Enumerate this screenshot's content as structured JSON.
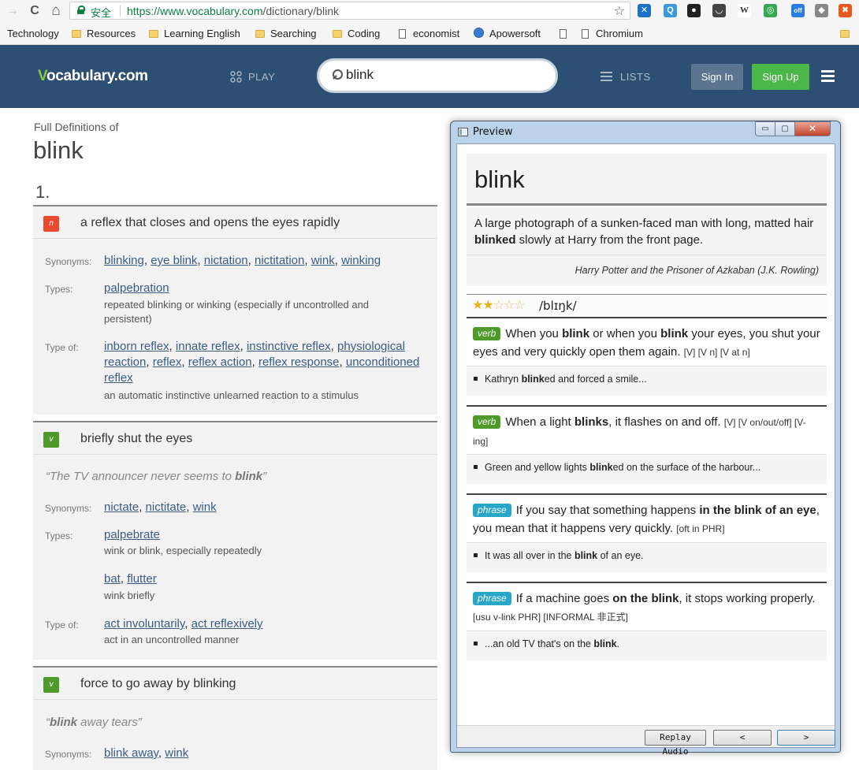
{
  "browser": {
    "nav": {
      "back": "→",
      "reload": "C",
      "home": "⌂"
    },
    "url": {
      "secure_label": "安全",
      "scheme": "https://",
      "host": "www.vocabulary.com",
      "path": "/dictionary/blink"
    },
    "star": "☆",
    "extensions": [
      {
        "icon": "ext-blue-icon",
        "color": "#1a73c8",
        "glyph": "✕"
      },
      {
        "icon": "ext-q-icon",
        "color": "#3a9ad9",
        "glyph": "Q"
      },
      {
        "icon": "ext-ghost-icon",
        "color": "#222222",
        "glyph": "●"
      },
      {
        "icon": "ext-pocket-icon",
        "color": "#444444",
        "glyph": "◡"
      },
      {
        "icon": "ext-wiki-icon",
        "color": "#ffffff",
        "glyph": "W"
      },
      {
        "icon": "ext-chrome-icon",
        "color": "#34a853",
        "glyph": "◎"
      },
      {
        "icon": "ext-off-icon",
        "color": "#2b7de0",
        "glyph": "off"
      },
      {
        "icon": "ext-gray-icon",
        "color": "#888888",
        "glyph": "◆"
      },
      {
        "icon": "ext-orange-icon",
        "color": "#e8571e",
        "glyph": "✖"
      }
    ],
    "bookmarks": [
      {
        "label": "Technology",
        "type": "none"
      },
      {
        "label": "Resources",
        "type": "folder"
      },
      {
        "label": "Learning English",
        "type": "folder"
      },
      {
        "label": "Searching",
        "type": "folder"
      },
      {
        "label": "Coding",
        "type": "folder"
      },
      {
        "label": "economist",
        "type": "page"
      },
      {
        "label": "Apowersoft",
        "type": "app"
      },
      {
        "label": "",
        "type": "page"
      },
      {
        "label": "Chromium",
        "type": "page"
      }
    ]
  },
  "site": {
    "logo_v": "V",
    "logo_rest": "ocabulary.com",
    "play": "PLAY",
    "search_value": "blink",
    "lists": "LISTS",
    "sign_in": "Sign In",
    "sign_up": "Sign Up"
  },
  "main": {
    "full_defs_label": "Full Definitions of",
    "headword": "blink",
    "sense_number": "1.",
    "senses": [
      {
        "pos": "n",
        "definition": "a reflex that closes and opens the eyes rapidly",
        "synonyms_label": "Synonyms:",
        "synonyms": [
          "blinking",
          "eye blink",
          "nictation",
          "nictitation",
          "wink",
          "winking"
        ],
        "types_label": "Types:",
        "types": [
          {
            "links": [
              "palpebration"
            ],
            "gloss": "repeated blinking or winking (especially if uncontrolled and persistent)"
          }
        ],
        "type_of_label": "Type of:",
        "type_of": {
          "links": [
            "inborn reflex",
            "innate reflex",
            "instinctive reflex",
            "physiological reaction",
            "reflex",
            "reflex action",
            "reflex response",
            "unconditioned reflex"
          ],
          "gloss": "an automatic instinctive unlearned reaction to a stimulus"
        }
      },
      {
        "pos": "v",
        "definition": "briefly shut the eyes",
        "quote_pre": "“The TV announcer never seems to ",
        "quote_word": "blink",
        "quote_post": "”",
        "synonyms_label": "Synonyms:",
        "synonyms": [
          "nictate",
          "nictitate",
          "wink"
        ],
        "types_label": "Types:",
        "types": [
          {
            "links": [
              "palpebrate"
            ],
            "gloss": "wink or blink, especially repeatedly"
          },
          {
            "links": [
              "bat",
              "flutter"
            ],
            "gloss": "wink briefly"
          }
        ],
        "type_of_label": "Type of:",
        "type_of": {
          "links": [
            "act involuntarily",
            "act reflexively"
          ],
          "gloss": "act in an uncontrolled manner"
        }
      },
      {
        "pos": "v",
        "definition": "force to go away by blinking",
        "quote_pre": "“",
        "quote_word": "blink",
        "quote_post": " away tears”",
        "synonyms_label": "Synonyms:",
        "synonyms": [
          "blink away",
          "wink"
        ]
      }
    ]
  },
  "preview": {
    "title": "Preview",
    "min": "▭",
    "max": "▢",
    "close": "✕",
    "word": "blink",
    "quote_pre": "A large photograph of a sunken-faced man with long, matted hair ",
    "quote_bold": "blinked",
    "quote_post": " slowly at Harry from the front page.",
    "source": "Harry Potter and the Prisoner of Azkaban (J.K. Rowling)",
    "stars_filled": "★★",
    "stars_empty": "☆☆☆",
    "rating": 2,
    "ipa": "/blɪŋk/",
    "entries": [
      {
        "tag": "verb",
        "def_parts": [
          [
            "When you ",
            false
          ],
          [
            "blink",
            true
          ],
          [
            " or when you ",
            false
          ],
          [
            "blink",
            true
          ],
          [
            " your eyes, you shut your eyes and very quickly open them again.",
            false
          ]
        ],
        "grammar": "[V]  [V n]  [V at n]",
        "example": [
          [
            "Kathryn ",
            false
          ],
          [
            "blink",
            true
          ],
          [
            "ed and forced a smile...",
            false
          ]
        ]
      },
      {
        "tag": "verb",
        "def_parts": [
          [
            "When a light ",
            false
          ],
          [
            "blinks",
            true
          ],
          [
            ", it flashes on and off.",
            false
          ]
        ],
        "grammar": "[V]  [V on/out/off]  [V-ing]",
        "example": [
          [
            "Green and yellow lights ",
            false
          ],
          [
            "blink",
            true
          ],
          [
            "ed on the surface of the harbour...",
            false
          ]
        ]
      },
      {
        "tag": "phrase",
        "def_parts": [
          [
            "If you say that something happens ",
            false
          ],
          [
            "in the blink of an eye",
            true
          ],
          [
            ", you mean that it happens very quickly.",
            false
          ]
        ],
        "grammar": "[oft in PHR]",
        "example": [
          [
            "It was all over in the ",
            false
          ],
          [
            "blink",
            true
          ],
          [
            " of an eye.",
            false
          ]
        ]
      },
      {
        "tag": "phrase",
        "def_parts": [
          [
            "If a machine goes ",
            false
          ],
          [
            "on the blink",
            true
          ],
          [
            ", it stops working properly.",
            false
          ]
        ],
        "grammar": "[usu v-link PHR]  [INFORMAL 非正式]",
        "example": [
          [
            "...an old TV that's on the ",
            false
          ],
          [
            "blink",
            true
          ],
          [
            ".",
            false
          ]
        ]
      }
    ],
    "replay": "Replay Audio",
    "prev": "<",
    "next": ">"
  }
}
